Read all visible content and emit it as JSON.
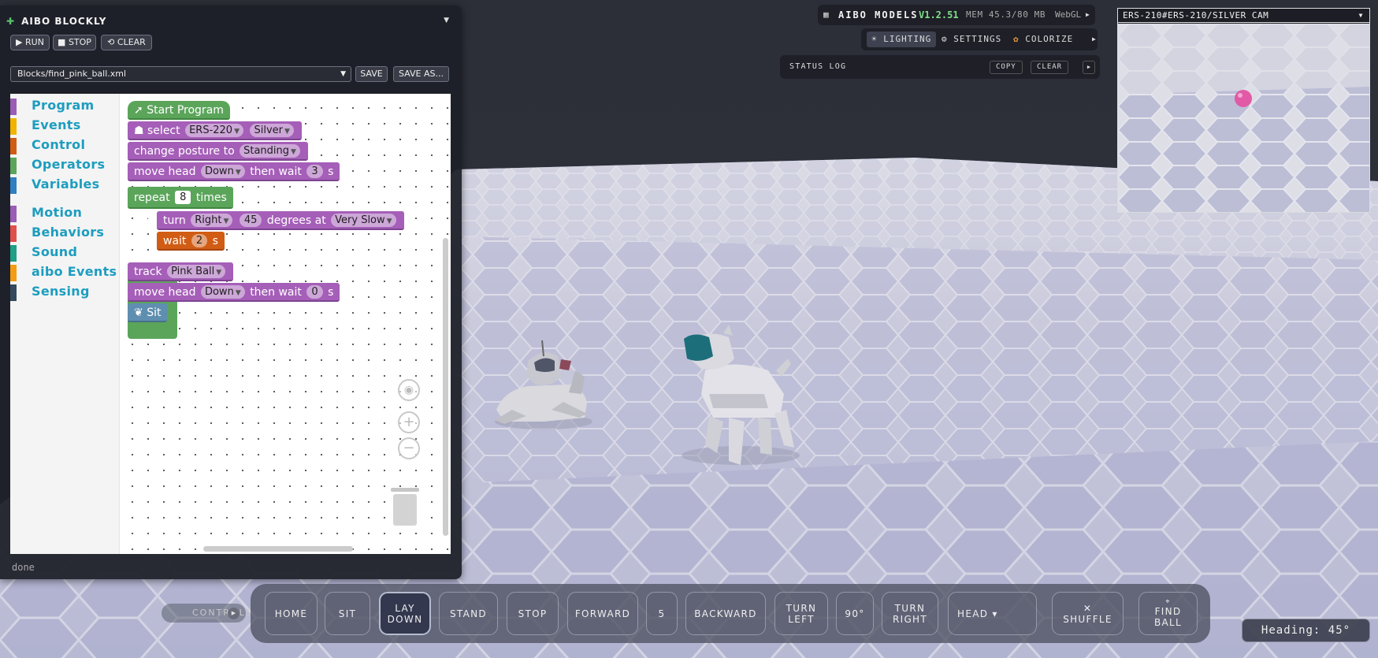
{
  "blockly": {
    "title": "AIBO BLOCKLY",
    "run_label": "RUN",
    "stop_label": "STOP",
    "clear_label": "CLEAR",
    "file": "Blocks/find_pink_ball.xml",
    "save_label": "SAVE",
    "save_as_label": "SAVE AS...",
    "status": "done",
    "categories": [
      {
        "label": "Program",
        "color": "#9a5cb4"
      },
      {
        "label": "Events",
        "color": "#f0b400"
      },
      {
        "label": "Control",
        "color": "#d05c14"
      },
      {
        "label": "Operators",
        "color": "#5ba55b"
      },
      {
        "label": "Variables",
        "color": "#2f7fc1"
      },
      {
        "label": "Motion",
        "color": "#9a5cb4"
      },
      {
        "label": "Behaviors",
        "color": "#e0504a"
      },
      {
        "label": "Sound",
        "color": "#1f9f85"
      },
      {
        "label": "aibo Events",
        "color": "#f39c12"
      },
      {
        "label": "Sensing",
        "color": "#34495e"
      }
    ],
    "blocks": {
      "start": "Start Program",
      "select_label": "select",
      "select_model": "ERS-220",
      "select_color": "Silver",
      "posture_label": "change posture to",
      "posture_value": "Standing",
      "head1_label": "move head",
      "head1_dir": "Down",
      "head1_then": "then wait",
      "head1_wait": "3",
      "head1_unit": "s",
      "repeat_label": "repeat",
      "repeat_count": "8",
      "repeat_times": "times",
      "do_label": "do",
      "turn_label": "turn",
      "turn_dir": "Right",
      "turn_deg": "45",
      "turn_degrees_at": "degrees at",
      "turn_speed": "Very Slow",
      "wait_label": "wait",
      "wait_value": "2",
      "wait_unit": "s",
      "track_label": "track",
      "track_target": "Pink Ball",
      "head2_label": "move head",
      "head2_dir": "Down",
      "head2_then": "then wait",
      "head2_wait": "0",
      "head2_unit": "s",
      "sit_label": "Sit"
    }
  },
  "models": {
    "title": "AIBO MODELS",
    "version": "V1.2.51",
    "memory": "MEM 45.3/80 MB",
    "renderer": "WebGL"
  },
  "lighting_bar": {
    "lighting": "LIGHTING",
    "settings": "SETTINGS",
    "colorize": "COLORIZE"
  },
  "status_log": {
    "title": "STATUS LOG",
    "copy": "COPY",
    "clear": "CLEAR"
  },
  "camera": {
    "selected": "ERS-210#ERS-210/SILVER CAM"
  },
  "controls": {
    "toggle_label": "CONTROLS",
    "home": "HOME",
    "sit": "SIT",
    "lay_1": "LAY",
    "lay_2": "DOWN",
    "stand": "STAND",
    "stop": "STOP",
    "forward": "FORWARD",
    "step": "5",
    "backward": "BACKWARD",
    "turn_left_1": "TURN",
    "turn_left_2": "LEFT",
    "angle": "90°",
    "turn_right_1": "TURN",
    "turn_right_2": "RIGHT",
    "head": "HEAD ▾",
    "shuffle_icon": "✕",
    "shuffle": "SHUFFLE",
    "find_icon": "⌖",
    "find_1": "FIND",
    "find_2": "BALL",
    "heading": "Heading: 45°"
  }
}
